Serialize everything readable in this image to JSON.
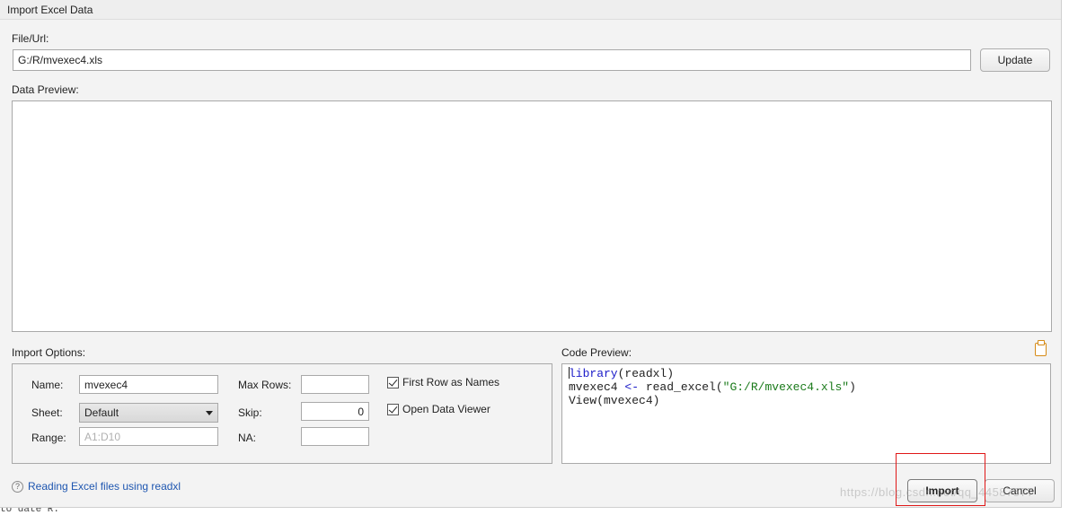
{
  "window": {
    "title": "Import Excel Data"
  },
  "file": {
    "label": "File/Url:",
    "value": "G:/R/mvexec4.xls",
    "update_label": "Update"
  },
  "preview": {
    "label": "Data Preview:"
  },
  "options": {
    "label": "Import Options:",
    "name_label": "Name:",
    "name_value": "mvexec4",
    "sheet_label": "Sheet:",
    "sheet_value": "Default",
    "range_label": "Range:",
    "range_placeholder": "A1:D10",
    "maxrows_label": "Max Rows:",
    "maxrows_value": "",
    "skip_label": "Skip:",
    "skip_value": "0",
    "na_label": "NA:",
    "na_value": "",
    "first_row_label": "First Row as Names",
    "first_row_checked": true,
    "open_viewer_label": "Open Data Viewer",
    "open_viewer_checked": true
  },
  "code": {
    "label": "Code Preview:",
    "line1_fn": "library",
    "line1_arg": "(readxl)",
    "line2_var": "mvexec4 ",
    "line2_op": "<-",
    "line2_fn": " read_excel(",
    "line2_str": "\"G:/R/mvexec4.xls\"",
    "line2_end": ")",
    "line3": "View(mvexec4)"
  },
  "help": {
    "icon": "?",
    "link": "Reading Excel files using readxl"
  },
  "actions": {
    "import_label": "Import",
    "cancel_label": "Cancel"
  },
  "watermark": "https://blog.csdn.net/qq_44587577",
  "background_text": "to date R."
}
